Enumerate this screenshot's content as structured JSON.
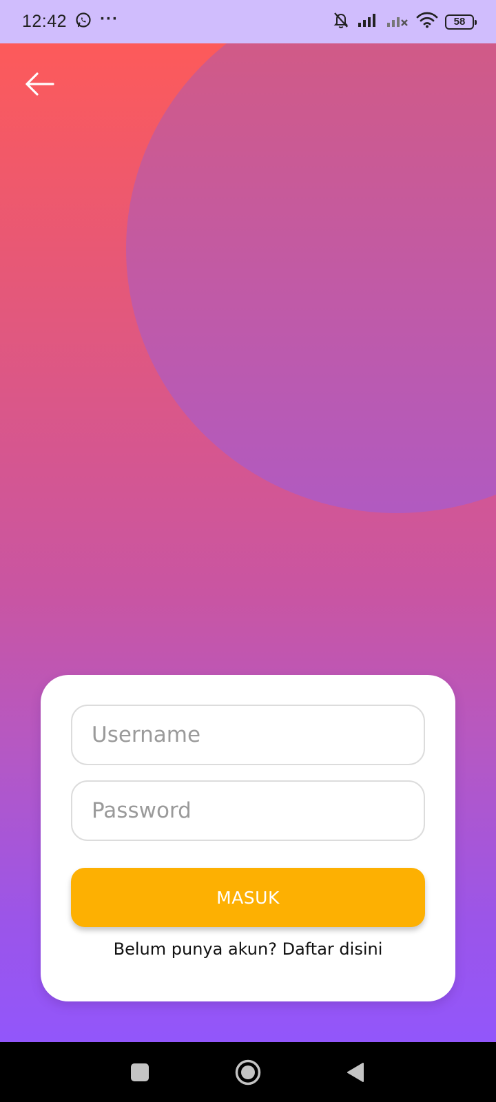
{
  "status_bar": {
    "time": "12:42",
    "more_indicator": "···",
    "battery_level": "58",
    "icons": [
      "whatsapp-icon",
      "bell-muted-icon",
      "signal-icon",
      "signal-no-service-icon",
      "wifi-icon",
      "battery-icon"
    ]
  },
  "header": {
    "back_icon": "arrow-left-icon"
  },
  "login_form": {
    "username_placeholder": "Username",
    "password_placeholder": "Password",
    "submit_label": "MASUK",
    "register_prompt": "Belum punya akun? Daftar disini"
  },
  "nav_bar": {
    "icons": [
      "recents-square-icon",
      "home-circle-icon",
      "back-triangle-icon"
    ]
  },
  "colors": {
    "status_bar_bg": "#d0bdfd",
    "gradient_top": "#fd5a5a",
    "gradient_bottom": "#9256fb",
    "button_accent": "#fdb002",
    "card_bg": "#ffffff"
  }
}
